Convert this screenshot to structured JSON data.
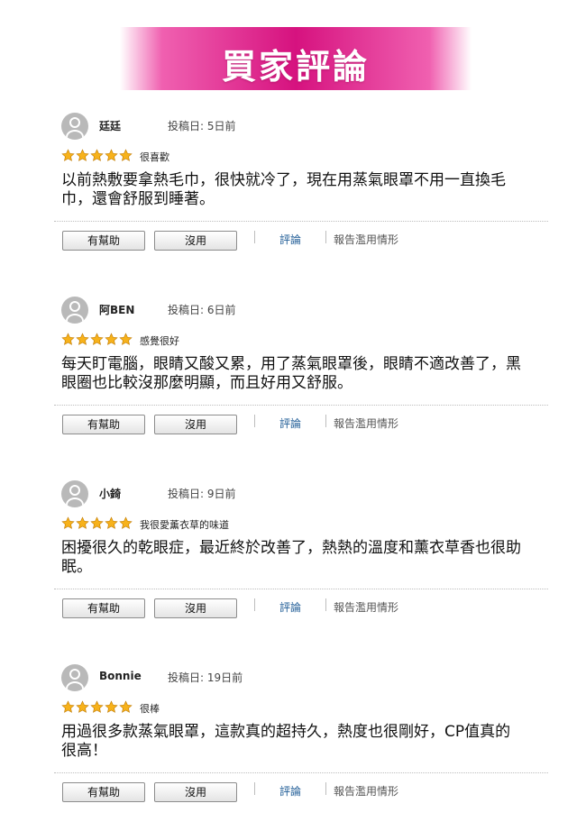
{
  "banner": {
    "title": "買家評論"
  },
  "colors": {
    "banner": "#d6127f",
    "star": "#f7b21b",
    "link": "#1f5c96"
  },
  "reviews": [
    {
      "name": "廷廷",
      "date": "投稿日: 5日前",
      "rating": 5,
      "title": "很喜歡",
      "body": "以前熱敷要拿熱毛巾，很快就冷了，現在用蒸氣眼罩不用一直換毛巾，還會舒服到睡著。",
      "helpful_label": "有幫助",
      "unhelpful_label": "沒用",
      "comment_label": "評論",
      "report_label": "報告濫用情形"
    },
    {
      "name": "阿BEN",
      "date": "投稿日: 6日前",
      "rating": 5,
      "title": "感覺很好",
      "body": "每天盯電腦，眼睛又酸又累，用了蒸氣眼罩後，眼睛不適改善了，黑眼圈也比較沒那麼明顯，而且好用又舒服。",
      "helpful_label": "有幫助",
      "unhelpful_label": "沒用",
      "comment_label": "評論",
      "report_label": "報告濫用情形"
    },
    {
      "name": "小錡",
      "date": "投稿日: 9日前",
      "rating": 5,
      "title": "我很愛薰衣草的味道",
      "body": "困擾很久的乾眼症，最近終於改善了，熱熱的溫度和薰衣草香也很助眠。",
      "helpful_label": "有幫助",
      "unhelpful_label": "沒用",
      "comment_label": "評論",
      "report_label": "報告濫用情形"
    },
    {
      "name": "Bonnie",
      "date": "投稿日: 19日前",
      "rating": 5,
      "title": "很棒",
      "body": "用過很多款蒸氣眼罩，這款真的超持久，熱度也很剛好，CP值真的很高！",
      "helpful_label": "有幫助",
      "unhelpful_label": "沒用",
      "comment_label": "評論",
      "report_label": "報告濫用情形"
    }
  ]
}
